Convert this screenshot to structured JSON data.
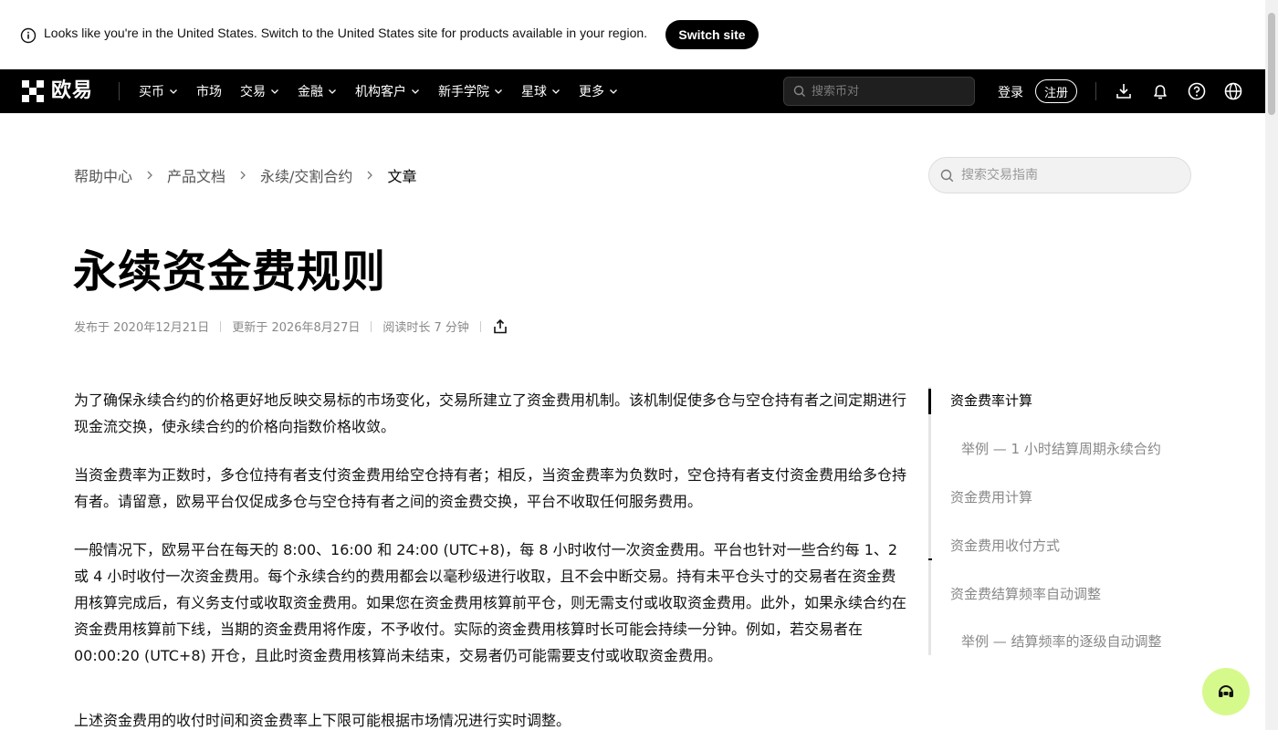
{
  "banner": {
    "message": "Looks like you're in the United States. Switch to the United States site for products available in your region.",
    "switch_label": "Switch site"
  },
  "navbar": {
    "logo_text": "欧易",
    "items": [
      {
        "label": "买币",
        "has_dropdown": true
      },
      {
        "label": "市场",
        "has_dropdown": false
      },
      {
        "label": "交易",
        "has_dropdown": true
      },
      {
        "label": "金融",
        "has_dropdown": true
      },
      {
        "label": "机构客户",
        "has_dropdown": true
      },
      {
        "label": "新手学院",
        "has_dropdown": true
      },
      {
        "label": "星球",
        "has_dropdown": true
      },
      {
        "label": "更多",
        "has_dropdown": true
      }
    ],
    "search_placeholder": "搜索币对",
    "login_label": "登录",
    "register_label": "注册",
    "icons": [
      "download-icon",
      "bell-icon",
      "help-icon",
      "globe-icon"
    ]
  },
  "breadcrumb": {
    "items": [
      "帮助中心",
      "产品文档",
      "永续/交割合约",
      "文章"
    ]
  },
  "guide_search": {
    "placeholder": "搜索交易指南"
  },
  "article": {
    "title": "永续资金费规则",
    "published": "发布于 2020年12月21日",
    "updated": "更新于 2026年8月27日",
    "read_time": "阅读时长 7 分钟",
    "paragraphs": [
      "为了确保永续合约的价格更好地反映交易标的市场变化，交易所建立了资金费用机制。该机制促使多仓与空仓持有者之间定期进行现金流交换，使永续合约的价格向指数价格收敛。",
      "当资金费率为正数时，多仓位持有者支付资金费用给空仓持有者；相反，当资金费率为负数时，空仓持有者支付资金费用给多仓持有者。请留意，欧易平台仅促成多仓与空仓持有者之间的资金费交换，平台不收取任何服务费用。",
      "一般情况下，欧易平台在每天的 8:00、16:00 和 24:00 (UTC+8)，每 8 小时收付一次资金费用。平台也针对一些合约每 1、2 或 4 小时收付一次资金费用。每个永续合约的费用都会以毫秒级进行收取，且不会中断交易。持有未平仓头寸的交易者在资金费用核算完成后，有义务支付或收取资金费用。如果您在资金费用核算前平仓，则无需支付或收取资金费用。此外，如果永续合约在资金费用核算前下线，当期的资金费用将作废，不予收付。实际的资金费用核算时长可能会持续一分钟。例如，若交易者在 00:00:20 (UTC+8) 开仓，且此时资金费用核算尚未结束，交易者仍可能需要支付或收取资金费用。",
      "上述资金费用的收付时间和资金费率上下限可能根据市场情况进行实时调整。"
    ]
  },
  "toc": {
    "items": [
      {
        "label": "资金费率计算",
        "active": true,
        "indent": false
      },
      {
        "label": "举例 — 1 小时结算周期永续合约",
        "active": false,
        "indent": true
      },
      {
        "label": "资金费用计算",
        "active": false,
        "indent": false
      },
      {
        "label": "资金费用收付方式",
        "active": false,
        "indent": false
      },
      {
        "label": "资金费结算频率自动调整",
        "active": false,
        "indent": false
      },
      {
        "label": "举例 — 结算频率的逐级自动调整",
        "active": false,
        "indent": true
      }
    ]
  },
  "colors": {
    "navbar_bg": "#000000",
    "support_bg": "#d6f98c",
    "text_primary": "#111111",
    "text_muted": "#888888"
  }
}
